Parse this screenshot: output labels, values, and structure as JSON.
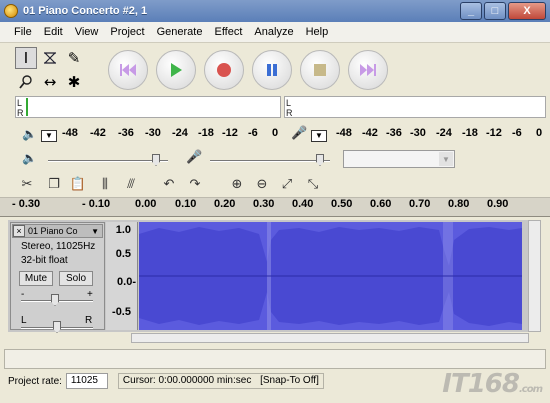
{
  "window": {
    "title": "01 Piano Concerto #2, 1",
    "minimize": "_",
    "maximize": "□",
    "close": "X"
  },
  "menu": [
    "File",
    "Edit",
    "View",
    "Project",
    "Generate",
    "Effect",
    "Analyze",
    "Help"
  ],
  "meters": {
    "playback_scale": [
      "-48",
      "-42",
      "-36",
      "-30",
      "-24",
      "-18",
      "-12",
      "-6",
      "0"
    ],
    "record_scale": [
      "-48",
      "-42",
      "-36",
      "-30",
      "-24",
      "-18",
      "-12",
      "-6",
      "0"
    ],
    "left_label": "L",
    "right_label": "R"
  },
  "ruler": {
    "ticks": [
      "- 0.30",
      "- 0.10",
      "0.00",
      "0.10",
      "0.20",
      "0.30",
      "0.40",
      "0.50",
      "0.60",
      "0.70",
      "0.80",
      "0.90"
    ]
  },
  "track": {
    "name": "01 Piano Co",
    "format": "Stereo, 11025Hz",
    "bits": "32-bit float",
    "mute": "Mute",
    "solo": "Solo",
    "gain_minus": "-",
    "gain_plus": "+",
    "pan_left": "L",
    "pan_right": "R",
    "scale": [
      "1.0",
      "0.5",
      "0.0-",
      "-0.5"
    ]
  },
  "status": {
    "project_rate_label": "Project rate:",
    "project_rate_value": "11025",
    "cursor_text": "Cursor: 0:00.000000 min:sec",
    "snap_text": "[Snap-To Off]"
  },
  "watermark": {
    "brand": "IT168",
    "suffix": ".com"
  },
  "colors": {
    "waveform": "#5b5bde",
    "titlebar": "#6d8cc0"
  }
}
